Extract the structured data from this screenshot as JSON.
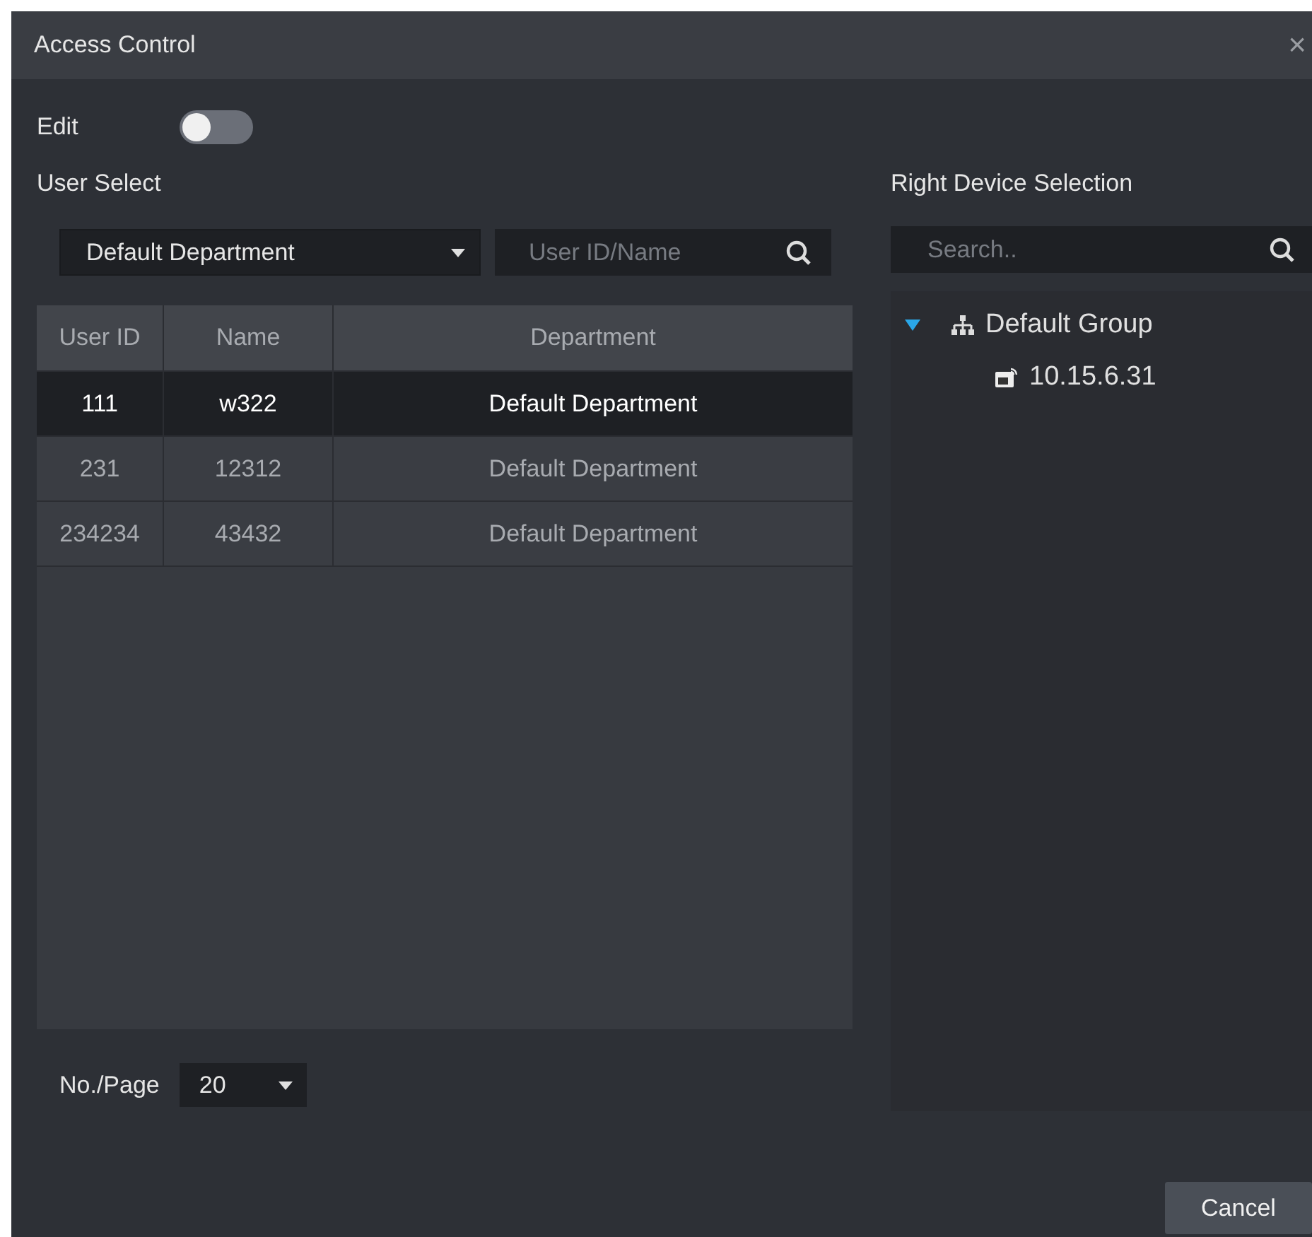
{
  "window": {
    "title": "Access Control",
    "close": "×"
  },
  "edit": {
    "label": "Edit",
    "on": false
  },
  "user_select": {
    "label": "User Select",
    "department": "Default Department",
    "search_placeholder": "User ID/Name"
  },
  "table": {
    "columns": [
      "User ID",
      "Name",
      "Department"
    ],
    "rows": [
      {
        "cells": [
          "111",
          "w322",
          "Default Department"
        ],
        "selected": true
      },
      {
        "cells": [
          "231",
          "12312",
          "Default Department"
        ],
        "selected": false
      },
      {
        "cells": [
          "234234",
          "43432",
          "Default Department"
        ],
        "selected": false
      }
    ]
  },
  "pagination": {
    "label": "No./Page",
    "value": "20"
  },
  "device_selection": {
    "label": "Right Device Selection",
    "search_placeholder": "Search..",
    "tree": [
      {
        "label": "Default Group",
        "expanded": true,
        "children": [
          {
            "label": "10.15.6.31"
          }
        ]
      }
    ]
  },
  "buttons": [
    "Cancel"
  ]
}
